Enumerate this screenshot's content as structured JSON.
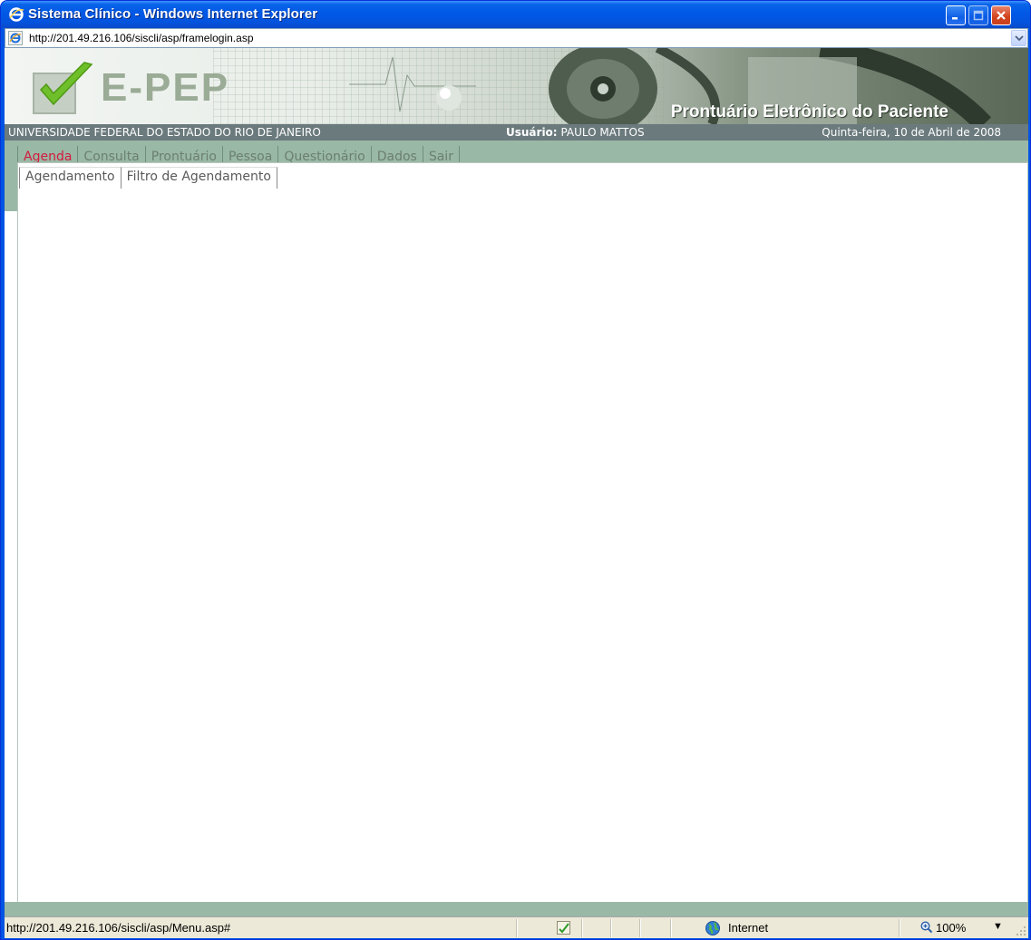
{
  "window": {
    "title": "Sistema Clínico - Windows Internet Explorer"
  },
  "address": {
    "url": "http://201.49.216.106/siscli/asp/framelogin.asp"
  },
  "banner": {
    "logo_text": "E-PEP",
    "subtitle": "Prontuário Eletrônico do Paciente"
  },
  "info": {
    "university": "UNIVERSIDADE FEDERAL DO ESTADO DO RIO DE JANEIRO",
    "user_label": "Usuário:",
    "user_name": "PAULO MATTOS",
    "date": "Quinta-feira, 10 de Abril de 2008"
  },
  "menu": {
    "items": [
      {
        "label": "Agenda",
        "active": true
      },
      {
        "label": "Consulta",
        "active": false
      },
      {
        "label": "Prontuário",
        "active": false
      },
      {
        "label": "Pessoa",
        "active": false
      },
      {
        "label": "Questionário",
        "active": false
      },
      {
        "label": "Dados",
        "active": false
      },
      {
        "label": "Sair",
        "active": false
      }
    ],
    "active_color": "#d31a3c"
  },
  "submenu": {
    "items": [
      {
        "label": "Agendamento"
      },
      {
        "label": "Filtro de Agendamento"
      }
    ]
  },
  "status": {
    "url": "http://201.49.216.106/siscli/asp/Menu.asp#",
    "zone": "Internet",
    "zoom": "100%"
  },
  "colors": {
    "menu_bg": "#9ab8a6",
    "infostrip_bg": "#6b7a7d",
    "titlebar": "#0058e6"
  }
}
